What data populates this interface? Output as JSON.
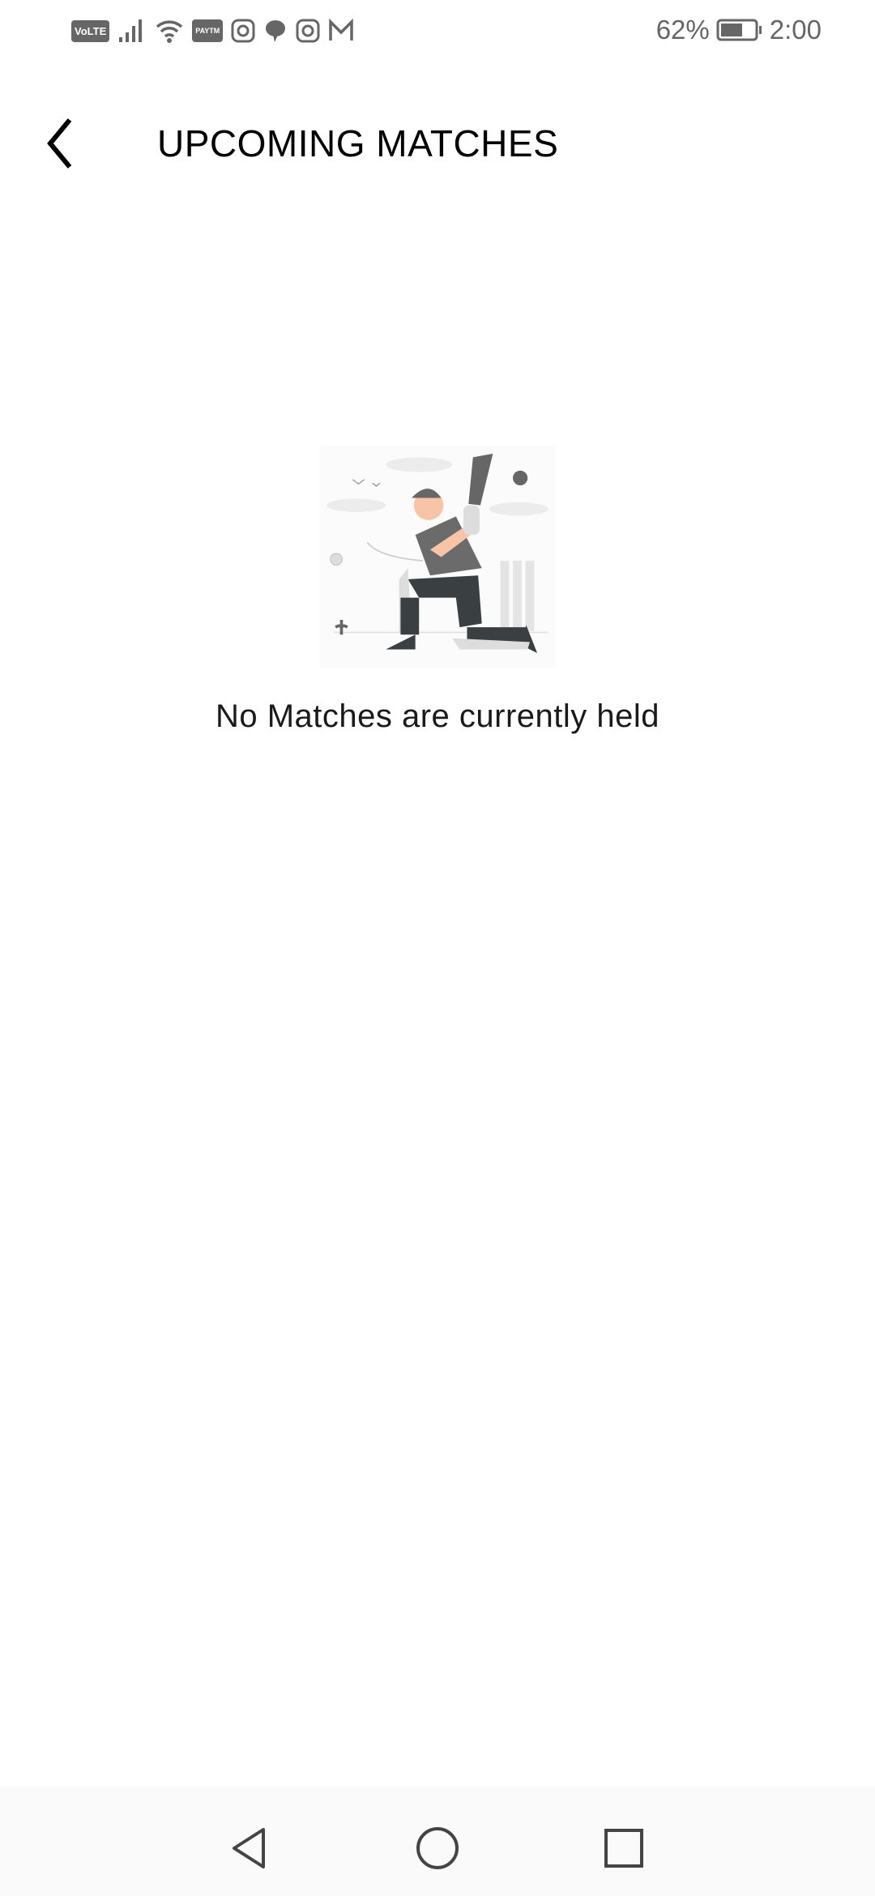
{
  "status_bar": {
    "left_icons": [
      "volte-icon",
      "signal-icon",
      "wifi-icon",
      "paytm-icon",
      "instagram-icon",
      "chat-icon",
      "instagram-icon",
      "gmail-icon"
    ],
    "volte_label": "VoLTE",
    "paytm_label": "PAYTM",
    "battery_percent": "62%",
    "battery_level": 62,
    "time": "2:00"
  },
  "header": {
    "title": "UPCOMING MATCHES",
    "back_icon": "chevron-left-icon"
  },
  "empty_state": {
    "illustration": "cricket-batsman-illustration",
    "message": "No Matches are currently held"
  },
  "nav_bar": {
    "icons": [
      "back-triangle-icon",
      "home-circle-icon",
      "recents-square-icon"
    ]
  },
  "colors": {
    "status_text": "#666666",
    "title": "#000000",
    "illustration_dark": "#3a3f42",
    "illustration_gray": "#6b6b6b",
    "skin": "#f7c4a5"
  }
}
